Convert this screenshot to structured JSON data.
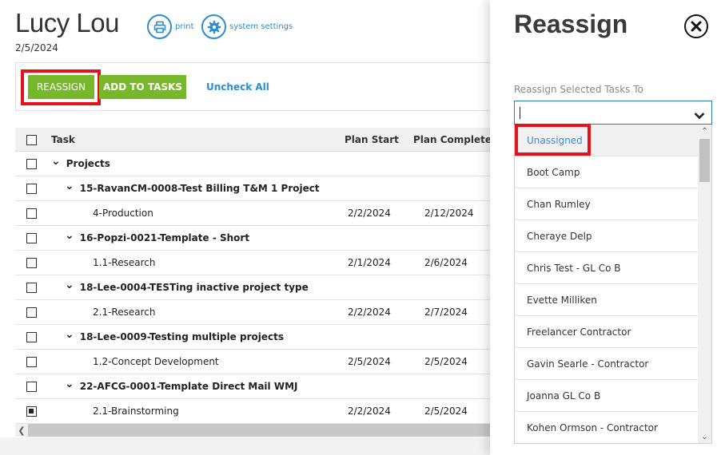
{
  "header": {
    "title": "Lucy Lou",
    "date": "2/5/2024",
    "print_label": "print",
    "settings_label": "system settings",
    "print_icon": "printer-icon",
    "settings_icon": "gear-icon"
  },
  "toolbar": {
    "reassign_label": "REASSIGN",
    "add_tasks_label": "ADD TO TASKS",
    "uncheck_all_label": "Uncheck All"
  },
  "table": {
    "headers": {
      "task": "Task",
      "plan_start": "Plan Start",
      "plan_complete": "Plan Complete"
    },
    "rows": [
      {
        "task": "Projects",
        "start": "",
        "complete": "",
        "level": 0,
        "group": true,
        "checked": false
      },
      {
        "task": "15-RavanCM-0008-Test Billing T&M 1 Project",
        "start": "",
        "complete": "",
        "level": 1,
        "group": true,
        "checked": false
      },
      {
        "task": "4-Production",
        "start": "2/2/2024",
        "complete": "2/12/2024",
        "level": 2,
        "group": false,
        "checked": false
      },
      {
        "task": "16-Popzi-0021-Template - Short",
        "start": "",
        "complete": "",
        "level": 1,
        "group": true,
        "checked": false
      },
      {
        "task": "1.1-Research",
        "start": "2/1/2024",
        "complete": "2/6/2024",
        "level": 2,
        "group": false,
        "checked": false
      },
      {
        "task": "18-Lee-0004-TESTing inactive project type",
        "start": "",
        "complete": "",
        "level": 1,
        "group": true,
        "checked": false
      },
      {
        "task": "2.1-Research",
        "start": "2/2/2024",
        "complete": "2/7/2024",
        "level": 2,
        "group": false,
        "checked": false
      },
      {
        "task": "18-Lee-0009-Testing multiple projects",
        "start": "",
        "complete": "",
        "level": 1,
        "group": true,
        "checked": false
      },
      {
        "task": "1.2-Concept Development",
        "start": "2/5/2024",
        "complete": "2/5/2024",
        "level": 2,
        "group": false,
        "checked": false
      },
      {
        "task": "22-AFCG-0001-Template Direct Mail WMJ",
        "start": "",
        "complete": "",
        "level": 1,
        "group": true,
        "checked": false
      },
      {
        "task": "2.1-Brainstorming",
        "start": "2/2/2024",
        "complete": "2/5/2024",
        "level": 2,
        "group": false,
        "checked": true
      }
    ]
  },
  "panel": {
    "title": "Reassign",
    "close_icon": "close-icon",
    "field_label": "Reassign Selected Tasks To",
    "input_value": "",
    "options": [
      "Unassigned",
      "Boot Camp",
      "Chan Rumley",
      "Cheraye Delp",
      "Chris Test - GL Co B",
      "Evette Milliken",
      "Freelancer Contractor",
      "Gavin Searle - Contractor",
      "Joanna GL Co B",
      "Kohen Ormson - Contractor"
    ],
    "selected_index": 0
  },
  "colors": {
    "accent_blue": "#2a8ecf",
    "button_green": "#77b82a",
    "highlight_red": "#e3121c",
    "selected_text": "#3d8be0"
  }
}
